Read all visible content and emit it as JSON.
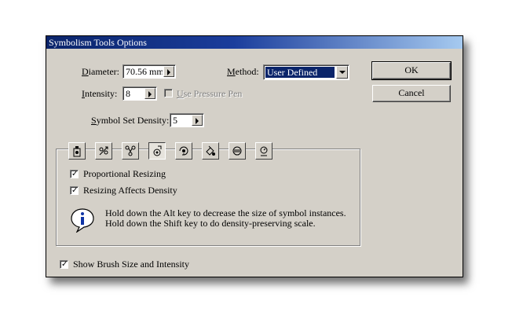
{
  "dialog": {
    "title": "Symbolism Tools Options",
    "diameter": {
      "label": "Diameter:",
      "value": "70.56 mm"
    },
    "method": {
      "label": "Method:",
      "value": "User Defined"
    },
    "intensity": {
      "label": "Intensity:",
      "value": "8",
      "pressure_label": "Use Pressure Pen"
    },
    "density": {
      "label": "Symbol Set Density:",
      "value": "5"
    },
    "buttons": {
      "ok": "OK",
      "cancel": "Cancel"
    },
    "tools": [
      {
        "name": "symbol-sprayer-icon"
      },
      {
        "name": "symbol-shifter-icon"
      },
      {
        "name": "symbol-scruncher-icon"
      },
      {
        "name": "symbol-sizer-icon"
      },
      {
        "name": "symbol-spinner-icon"
      },
      {
        "name": "symbol-stainer-icon"
      },
      {
        "name": "symbol-screener-icon"
      },
      {
        "name": "symbol-styler-icon"
      }
    ],
    "options": {
      "proportional_resizing": "Proportional Resizing",
      "resizing_affects_density": "Resizing Affects Density"
    },
    "info_line1": "Hold down the Alt key to decrease the size of symbol instances.",
    "info_line2": "Hold down the Shift key to do density-preserving scale.",
    "show_brush": "Show Brush Size and Intensity"
  }
}
